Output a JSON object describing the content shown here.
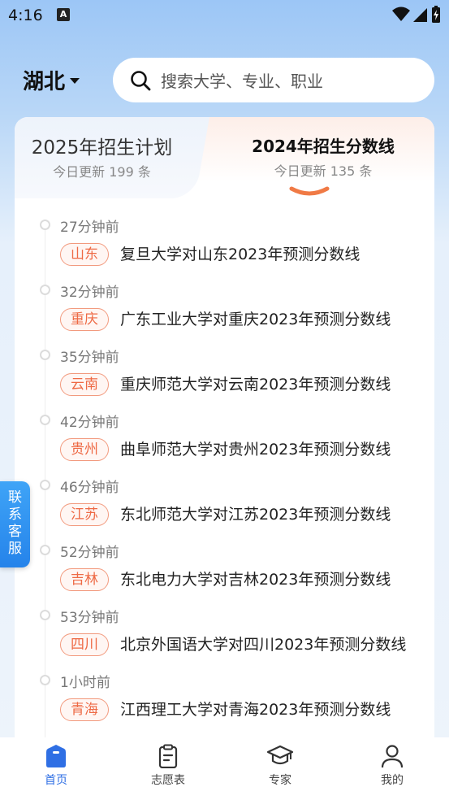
{
  "status_bar": {
    "time": "4:16",
    "notification_icon": "A"
  },
  "header": {
    "region": "湖北",
    "search_placeholder": "搜索大学、专业、职业"
  },
  "tabs": [
    {
      "title": "2025年招生计划",
      "subtitle": "今日更新 199 条",
      "active": false
    },
    {
      "title": "2024年招生分数线",
      "subtitle": "今日更新 135 条",
      "active": true
    }
  ],
  "timeline": [
    {
      "time": "27分钟前",
      "tag": "山东",
      "text": "复旦大学对山东2023年预测分数线"
    },
    {
      "time": "32分钟前",
      "tag": "重庆",
      "text": "广东工业大学对重庆2023年预测分数线"
    },
    {
      "time": "35分钟前",
      "tag": "云南",
      "text": "重庆师范大学对云南2023年预测分数线"
    },
    {
      "time": "42分钟前",
      "tag": "贵州",
      "text": "曲阜师范大学对贵州2023年预测分数线"
    },
    {
      "time": "46分钟前",
      "tag": "江苏",
      "text": "东北师范大学对江苏2023年预测分数线"
    },
    {
      "time": "52分钟前",
      "tag": "吉林",
      "text": "东北电力大学对吉林2023年预测分数线"
    },
    {
      "time": "53分钟前",
      "tag": "四川",
      "text": "北京外国语大学对四川2023年预测分数线"
    },
    {
      "time": "1小时前",
      "tag": "青海",
      "text": "江西理工大学对青海2023年预测分数线"
    }
  ],
  "floating": {
    "customer_service": "联系客服"
  },
  "tabbar": [
    {
      "label": "首页",
      "icon": "home-icon",
      "active": true
    },
    {
      "label": "志愿表",
      "icon": "clipboard-icon",
      "active": false
    },
    {
      "label": "专家",
      "icon": "graduation-cap-icon",
      "active": false
    },
    {
      "label": "我的",
      "icon": "user-icon",
      "active": false
    }
  ],
  "colors": {
    "accent": "#2f6fe4",
    "tag": "#ee6a45"
  }
}
